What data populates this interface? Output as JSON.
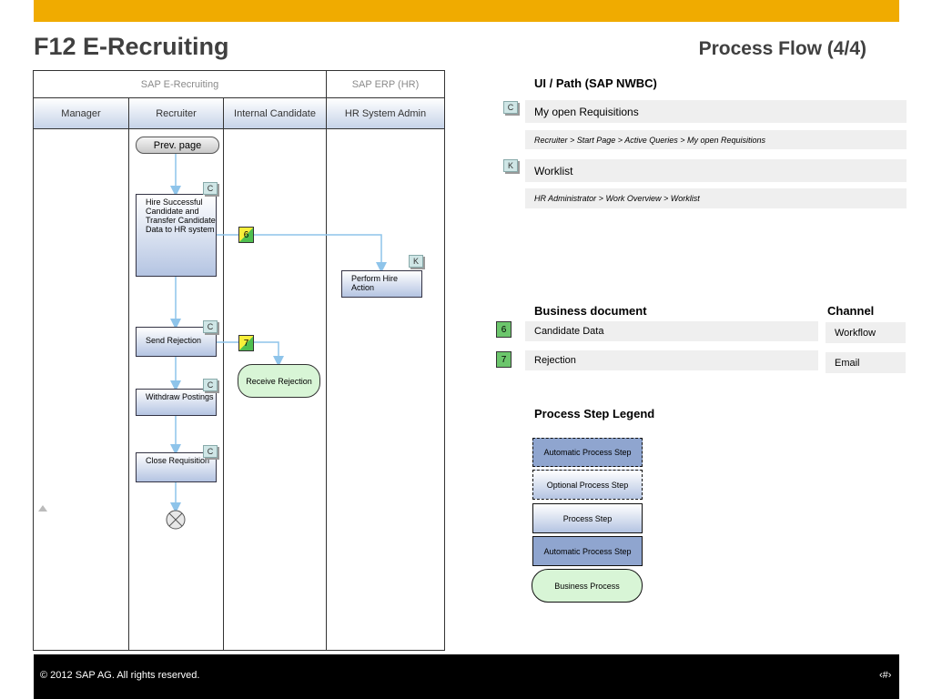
{
  "header": {
    "title": "F12 E-Recruiting",
    "subtitle": "Process Flow (4/4)"
  },
  "swimlanes": {
    "groups": [
      "SAP E-Recruiting",
      "SAP ERP (HR)"
    ],
    "roles": [
      "Manager",
      "Recruiter",
      "Internal Candidate",
      "HR System Admin"
    ]
  },
  "diagram": {
    "prev_page": "Prev. page",
    "steps": {
      "hire": "Hire Successful Candidate and Transfer Candidate Data to HR system",
      "perform_hire": "Perform Hire Action",
      "send_rejection": "Send Rejection",
      "receive_rejection": "Receive Rejection",
      "withdraw": "Withdraw Postings",
      "close": "Close Requisition"
    },
    "badges": {
      "c": "C",
      "k": "K"
    },
    "doc_numbers": [
      "6",
      "7"
    ]
  },
  "ui_path": {
    "heading": "UI / Path (SAP NWBC)",
    "items": [
      {
        "badge": "C",
        "title": "My open Requisitions",
        "path": "Recruiter > Start Page > Active Queries > My open Requisitions"
      },
      {
        "badge": "K",
        "title": "Worklist",
        "path": "HR Administrator > Work Overview > Worklist"
      }
    ]
  },
  "business_docs": {
    "heading": "Business document",
    "channel_heading": "Channel",
    "items": [
      {
        "num": "6",
        "doc": "Candidate Data",
        "channel": "Workflow"
      },
      {
        "num": "7",
        "doc": "Rejection",
        "channel": "Email"
      }
    ]
  },
  "legend": {
    "heading": "Process Step Legend",
    "items": [
      "Automatic Process Step",
      "Optional Process Step",
      "Process Step",
      "Automatic Process Step",
      "Business Process"
    ]
  },
  "footer": {
    "copyright": "©  2012 SAP AG. All rights reserved.",
    "page": "‹#›"
  },
  "colors": {
    "accent_bar": "#f0ab00",
    "step_fill": "#b4c4e2",
    "connector": "#8ec4ea",
    "business_process_fill": "#d8f5d6"
  }
}
